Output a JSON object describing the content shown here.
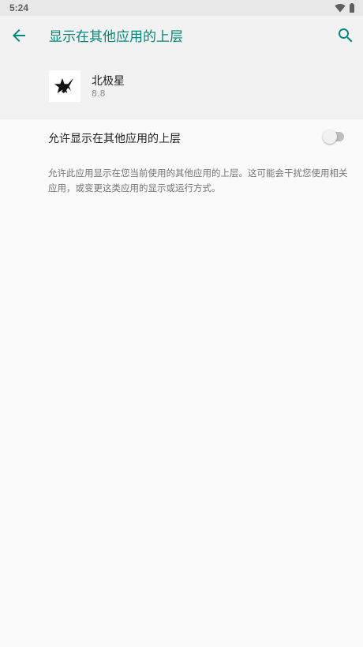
{
  "status_bar": {
    "time": "5:24",
    "icons": [
      "wifi-icon",
      "battery-icon"
    ]
  },
  "app_bar": {
    "title": "显示在其他应用的上层",
    "back_icon": "arrow-back-icon",
    "search_icon": "search-icon"
  },
  "app": {
    "name": "北极星",
    "version": "8.8",
    "icon": "star-logo-icon"
  },
  "permission": {
    "label": "允许显示在其他应用的上层",
    "enabled": false,
    "description": "允许此应用显示在您当前使用的其他应用的上层。这可能会干扰您使用相关应用，或变更这类应用的显示或运行方式。"
  },
  "colors": {
    "accent": "#00897b",
    "background": "#fafafa",
    "header_background": "#f2f2f2",
    "status_bar": "#e8e8e8"
  }
}
